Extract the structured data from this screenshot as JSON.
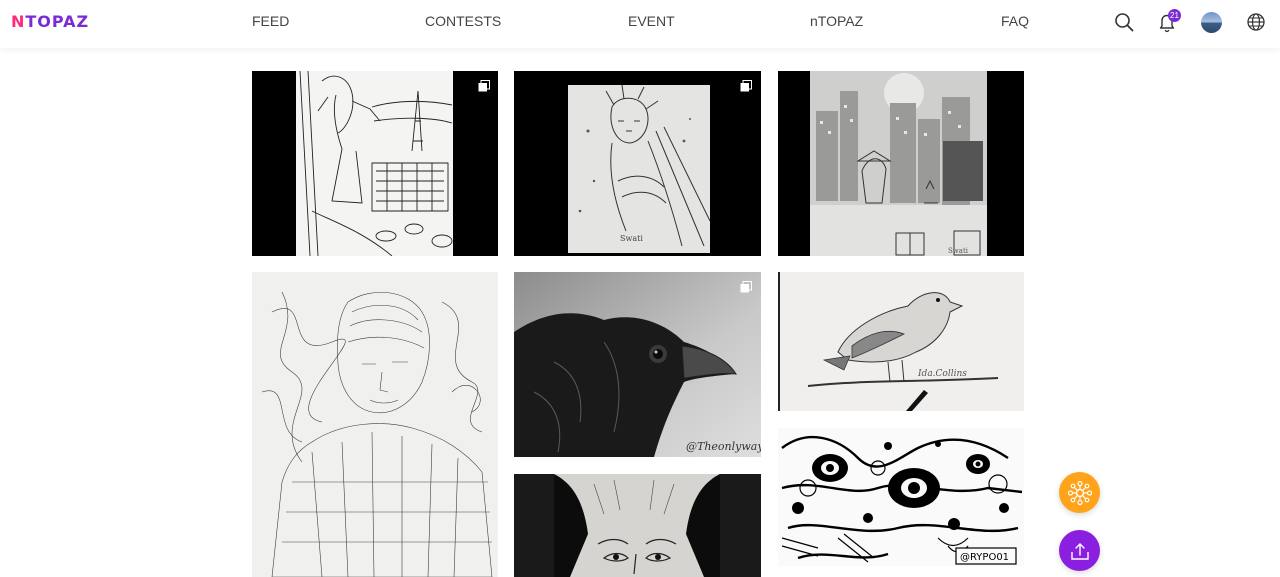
{
  "brand": {
    "logo_text": "NTOPAZ",
    "logo_accent": "N",
    "logo_rest": "TOPAZ",
    "primary_color": "#7a2bd6",
    "accent_color": "#ff2a7a"
  },
  "nav": {
    "items": [
      {
        "label": "FEED"
      },
      {
        "label": "CONTESTS"
      },
      {
        "label": "EVENT"
      },
      {
        "label": "nTOPAZ"
      },
      {
        "label": "FAQ"
      }
    ]
  },
  "header_icons": {
    "search": "search-icon",
    "notifications": "bell-icon",
    "notification_count": "21",
    "avatar": "avatar",
    "language": "globe-icon"
  },
  "gallery": {
    "tiles": [
      {
        "subject": "woman at window with Eiffel Tower sketch",
        "multi_image": true
      },
      {
        "subject": "old man hugging tree sketch",
        "multi_image": true,
        "signature": "Swati"
      },
      {
        "subject": "girl and cat on city balcony sketch",
        "multi_image": false
      },
      {
        "subject": "scribble portrait of a man",
        "multi_image": false
      },
      {
        "subject": "crow charcoal drawing",
        "multi_image": true,
        "watermark": "@Theonlyway"
      },
      {
        "subject": "sparrow on branch pencil drawing",
        "multi_image": false
      },
      {
        "subject": "portrait of a woman ink drawing",
        "multi_image": false
      },
      {
        "subject": "zentangle doodle",
        "multi_image": false,
        "watermark": "@RYPO01"
      }
    ]
  },
  "fabs": {
    "orange": {
      "icon": "network-icon",
      "color": "#ffa31a"
    },
    "purple": {
      "icon": "upload-icon",
      "color": "#8a1fe0"
    }
  }
}
